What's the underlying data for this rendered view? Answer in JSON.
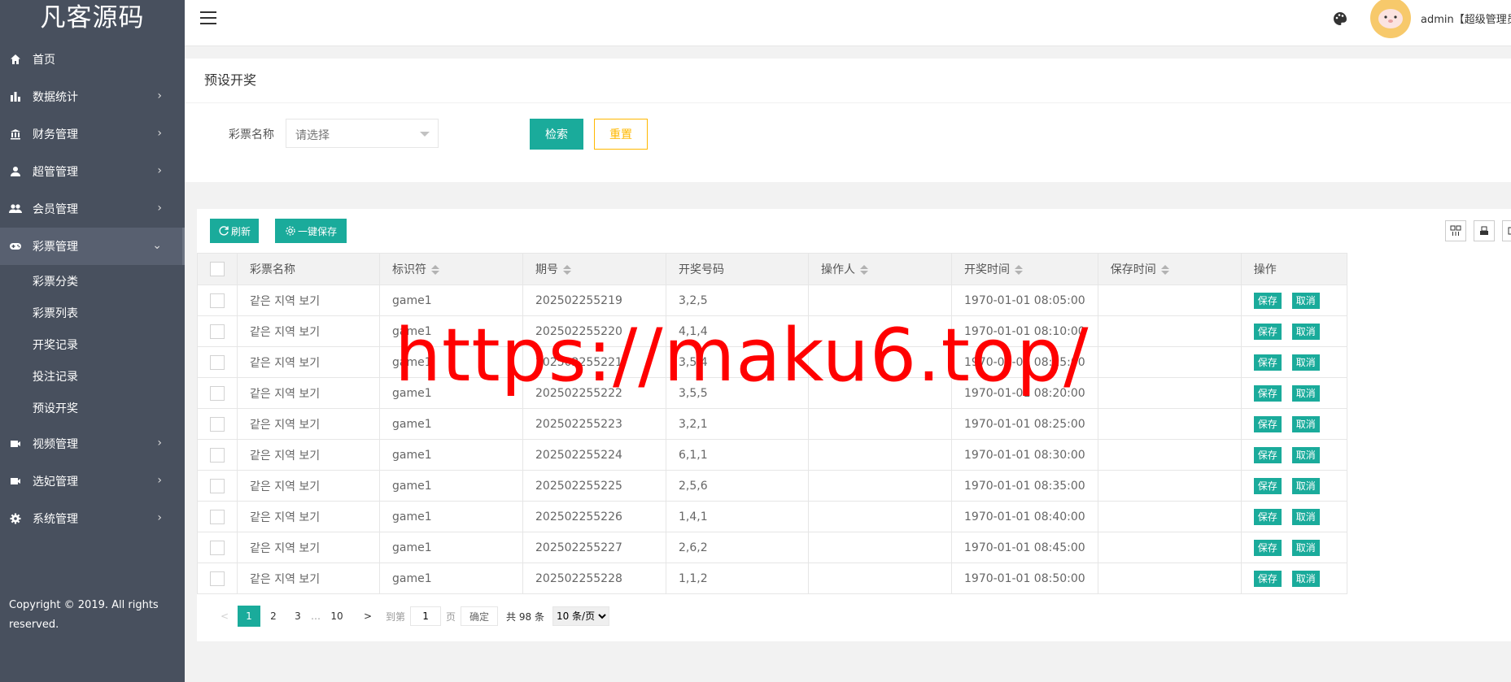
{
  "brand": {
    "logo_text": "凡客源码"
  },
  "sidebar": {
    "items": [
      {
        "label": "首页",
        "icon": "home-icon",
        "has_arrow": false
      },
      {
        "label": "数据统计",
        "icon": "bar-chart-icon",
        "has_arrow": true
      },
      {
        "label": "财务管理",
        "icon": "bank-icon",
        "has_arrow": true
      },
      {
        "label": "超管管理",
        "icon": "user-icon",
        "has_arrow": true
      },
      {
        "label": "会员管理",
        "icon": "users-icon",
        "has_arrow": true
      },
      {
        "label": "彩票管理",
        "icon": "gamepad-icon",
        "has_arrow": true,
        "expanded": true
      }
    ],
    "sub_items": [
      {
        "label": "彩票分类"
      },
      {
        "label": "彩票列表"
      },
      {
        "label": "开奖记录"
      },
      {
        "label": "投注记录"
      },
      {
        "label": "预设开奖"
      }
    ],
    "items_after": [
      {
        "label": "视频管理",
        "icon": "video-icon",
        "has_arrow": true
      },
      {
        "label": "选妃管理",
        "icon": "video-icon",
        "has_arrow": true
      },
      {
        "label": "系统管理",
        "icon": "gear-icon",
        "has_arrow": true
      }
    ],
    "copyright": "Copyright © 2019. All rights reserved.",
    "arrow_right": "›",
    "arrow_down": "⌄"
  },
  "header": {
    "user_name": "admin【超级管理员】"
  },
  "search_panel": {
    "title": "预设开奖",
    "lottery_label": "彩票名称",
    "lottery_placeholder": "请选择",
    "search_button": "检索",
    "reset_button": "重置"
  },
  "toolbar": {
    "refresh_label": "刷新",
    "save_all_label": "一键保存"
  },
  "table": {
    "columns": [
      "彩票名称",
      "标识符",
      "期号",
      "开奖号码",
      "操作人",
      "开奖时间",
      "保存时间",
      "操作"
    ],
    "rows": [
      {
        "name": "같은 지역 보기",
        "id": "game1",
        "period": "202502255219",
        "numbers": "3,2,5",
        "operator": "",
        "draw_time": "1970-01-01 08:05:00",
        "save_time": ""
      },
      {
        "name": "같은 지역 보기",
        "id": "game1",
        "period": "202502255220",
        "numbers": "4,1,4",
        "operator": "",
        "draw_time": "1970-01-01 08:10:00",
        "save_time": ""
      },
      {
        "name": "같은 지역 보기",
        "id": "game1",
        "period": "202502255221",
        "numbers": "3,5,4",
        "operator": "",
        "draw_time": "1970-01-01 08:15:00",
        "save_time": ""
      },
      {
        "name": "같은 지역 보기",
        "id": "game1",
        "period": "202502255222",
        "numbers": "3,5,5",
        "operator": "",
        "draw_time": "1970-01-01 08:20:00",
        "save_time": ""
      },
      {
        "name": "같은 지역 보기",
        "id": "game1",
        "period": "202502255223",
        "numbers": "3,2,1",
        "operator": "",
        "draw_time": "1970-01-01 08:25:00",
        "save_time": ""
      },
      {
        "name": "같은 지역 보기",
        "id": "game1",
        "period": "202502255224",
        "numbers": "6,1,1",
        "operator": "",
        "draw_time": "1970-01-01 08:30:00",
        "save_time": ""
      },
      {
        "name": "같은 지역 보기",
        "id": "game1",
        "period": "202502255225",
        "numbers": "2,5,6",
        "operator": "",
        "draw_time": "1970-01-01 08:35:00",
        "save_time": ""
      },
      {
        "name": "같은 지역 보기",
        "id": "game1",
        "period": "202502255226",
        "numbers": "1,4,1",
        "operator": "",
        "draw_time": "1970-01-01 08:40:00",
        "save_time": ""
      },
      {
        "name": "같은 지역 보기",
        "id": "game1",
        "period": "202502255227",
        "numbers": "2,6,2",
        "operator": "",
        "draw_time": "1970-01-01 08:45:00",
        "save_time": ""
      },
      {
        "name": "같은 지역 보기",
        "id": "game1",
        "period": "202502255228",
        "numbers": "1,1,2",
        "operator": "",
        "draw_time": "1970-01-01 08:50:00",
        "save_time": ""
      }
    ],
    "save_label": "保存",
    "cancel_label": "取消"
  },
  "pagination": {
    "prev": "<",
    "pages": [
      "1",
      "2",
      "3"
    ],
    "current_page": "1",
    "ellipsis": "…",
    "last_page": "10",
    "next": ">",
    "goto_label": "到第",
    "goto_value": "1",
    "page_unit": "页",
    "confirm": "确定",
    "total": "共 98 条",
    "page_size": "10 条/页"
  },
  "watermark": "https://maku6.top/",
  "colors": {
    "sidebar_bg": "#48505e",
    "accent": "#1aab9b",
    "reset_border": "#ffb800",
    "draw_numbers": "#ff0000",
    "watermark": "#ff0000"
  }
}
